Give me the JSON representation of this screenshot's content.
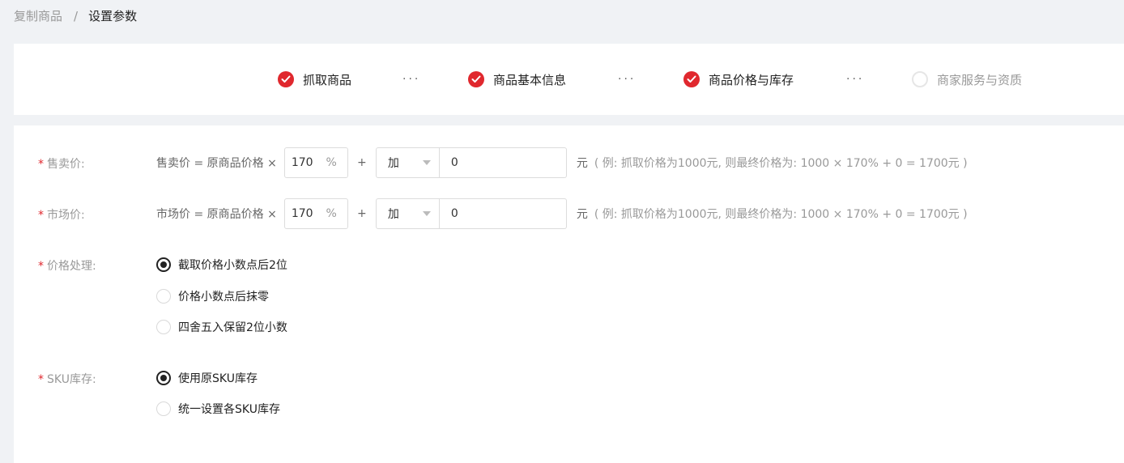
{
  "breadcrumb": {
    "prev": "复制商品",
    "separator": "/",
    "current": "设置参数"
  },
  "steps": [
    {
      "label": "抓取商品",
      "status": "done"
    },
    {
      "label": "商品基本信息",
      "status": "done"
    },
    {
      "label": "商品价格与库存",
      "status": "done"
    },
    {
      "label": "商家服务与资质",
      "status": "pending"
    }
  ],
  "step_dots": "···",
  "form": {
    "required_mark": "*",
    "sell_price": {
      "label": "售卖价:",
      "formula": "售卖价 = 原商品价格 ×",
      "percent_value": "170",
      "percent_unit": "%",
      "plus": "+",
      "operator": "加",
      "add_value": "0",
      "currency": "元",
      "example": "( 例: 抓取价格为1000元, 则最终价格为: 1000 × 170% + 0 = 1700元 )"
    },
    "market_price": {
      "label": "市场价:",
      "formula": "市场价 = 原商品价格 ×",
      "percent_value": "170",
      "percent_unit": "%",
      "plus": "+",
      "operator": "加",
      "add_value": "0",
      "currency": "元",
      "example": "( 例: 抓取价格为1000元, 则最终价格为: 1000 × 170% + 0 = 1700元 )"
    },
    "price_handling": {
      "label": "价格处理:",
      "options": [
        {
          "label": "截取价格小数点后2位",
          "checked": true
        },
        {
          "label": "价格小数点后抹零",
          "checked": false
        },
        {
          "label": "四舍五入保留2位小数",
          "checked": false
        }
      ]
    },
    "sku_stock": {
      "label": "SKU库存:",
      "options": [
        {
          "label": "使用原SKU库存",
          "checked": true
        },
        {
          "label": "统一设置各SKU库存",
          "checked": false
        }
      ]
    }
  },
  "colors": {
    "accent": "#e0282e",
    "muted": "#999999",
    "border": "#dcdcdc"
  }
}
